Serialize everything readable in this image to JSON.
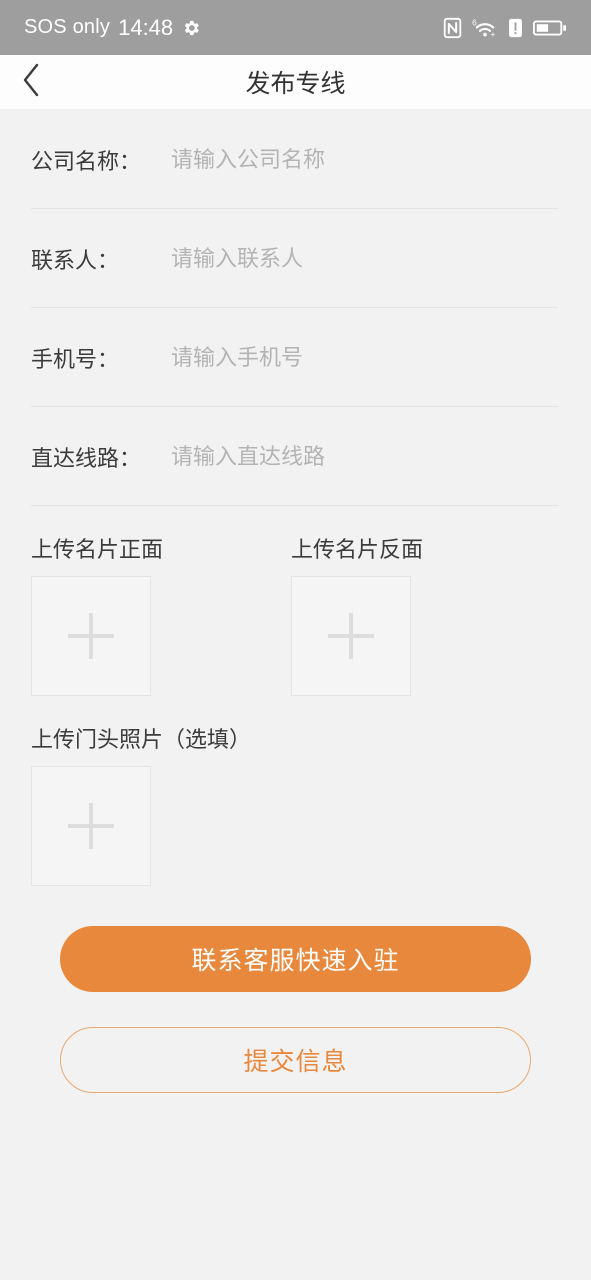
{
  "status_bar": {
    "carrier": "SOS only",
    "time": "14:48",
    "icons": [
      "gear-icon",
      "nfc-icon",
      "wifi-6-plus-icon",
      "alert-icon",
      "battery-icon"
    ]
  },
  "header": {
    "back_icon": "chevron-left-icon",
    "title": "发布专线"
  },
  "form": {
    "fields": [
      {
        "label": "公司名称：",
        "placeholder": "请输入公司名称",
        "value": ""
      },
      {
        "label": "联系人：",
        "placeholder": "请输入联系人",
        "value": ""
      },
      {
        "label": "手机号：",
        "placeholder": "请输入手机号",
        "value": ""
      },
      {
        "label": "直达线路：",
        "placeholder": "请输入直达线路",
        "value": ""
      }
    ]
  },
  "uploads": {
    "card_front": {
      "label": "上传名片正面",
      "icon": "plus-icon"
    },
    "card_back": {
      "label": "上传名片反面",
      "icon": "plus-icon"
    },
    "storefront": {
      "label": "上传门头照片（选填）",
      "icon": "plus-icon"
    }
  },
  "actions": {
    "primary_label": "联系客服快速入驻",
    "secondary_label": "提交信息"
  },
  "colors": {
    "accent": "#e8883c",
    "accent_border": "#e8a86f",
    "status_bar_bg": "#9e9e9e",
    "page_bg": "#f2f2f2",
    "header_bg": "#fdfdfd",
    "label_text": "#3b3b3b",
    "placeholder_text": "#b4b4b4"
  }
}
